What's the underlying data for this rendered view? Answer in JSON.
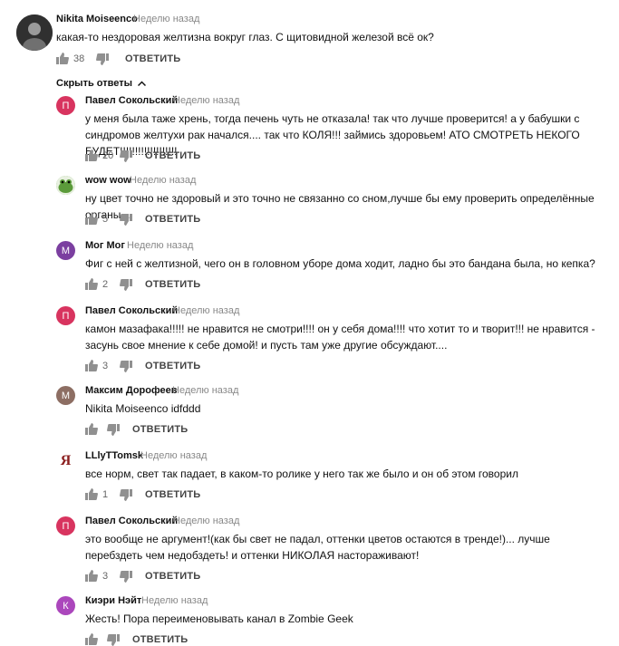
{
  "main_comment": {
    "author": "Nikita Moiseenco",
    "time": "Неделю назад",
    "text": "какая-то нездоровая желтизна вокруг глаз. С щитовидной железой всё ок?",
    "likes": "38",
    "reply_label": "ОТВЕТИТЬ"
  },
  "toggle_label": "Скрыть ответы",
  "replies": [
    {
      "author": "Павел Сокольский",
      "time": "Неделю назад",
      "avatar": "П",
      "avatar_color": "#d8345f",
      "text": "у меня была таже хрень, тогда печень чуть не отказала! так что лучше проверится! а у бабушки с синдромов желтухи рак начался.... так что КОЛЯ!!! займись здоровьем! АТО СМОТРЕТЬ НЕКОГО БУДЕТ!!!!!!!!!!!!!!!!!!!",
      "likes": "20",
      "reply_label": "ОТВЕТИТЬ"
    },
    {
      "author": "wow wow",
      "time": "Неделю назад",
      "avatar": "",
      "avatar_color": "#6aa84f",
      "text": "ну цвет точно не здоровый и это точно не связанно со сном,лучше бы ему проверить определённые органы...",
      "likes": "5",
      "reply_label": "ОТВЕТИТЬ"
    },
    {
      "author": "Мог Мог",
      "time": "Неделю назад",
      "avatar": "М",
      "avatar_color": "#7b3fa0",
      "text": "Фиг с ней с желтизной, чего он в головном уборе дома ходит, ладно бы это бандана была, но кепка?",
      "likes": "2",
      "reply_label": "ОТВЕТИТЬ"
    },
    {
      "author": "Павел Сокольский",
      "time": "Неделю назад",
      "avatar": "П",
      "avatar_color": "#d8345f",
      "text": "камон мазафака!!!!! не нравится не смотри!!!! он у себя дома!!!! что хотит то и творит!!! не нравится - засунь свое мнение к себе домой! и пусть там уже другие обсуждают....",
      "likes": "3",
      "reply_label": "ОТВЕТИТЬ"
    },
    {
      "author": "Максим Дорофеев",
      "time": "Неделю назад",
      "avatar": "М",
      "avatar_color": "#8d6e63",
      "text": "Nikita Moiseenco idfddd",
      "likes": "",
      "reply_label": "ОТВЕТИТЬ"
    },
    {
      "author": "LLlyTTomsk",
      "time": "Неделю назад",
      "avatar": "Я",
      "avatar_color": "#ffffff",
      "text": "все норм, свет так падает, в каком-то ролике у него так же было и он об этом говорил",
      "likes": "1",
      "reply_label": "ОТВЕТИТЬ"
    },
    {
      "author": "Павел Сокольский",
      "time": "Неделю назад",
      "avatar": "П",
      "avatar_color": "#d8345f",
      "text": "это вообще не аргумент!(как бы свет не падал, оттенки цветов остаются в тренде!)... лучше перебздеть чем недобздеть! и оттенки НИКОЛАЯ настораживают!",
      "likes": "3",
      "reply_label": "ОТВЕТИТЬ"
    },
    {
      "author": "Киэри Нэйт",
      "time": "Неделю назад",
      "avatar": "К",
      "avatar_color": "#ab47bc",
      "text": "Жесть! Пора переименовывать канал в Zombie Geek",
      "likes": "",
      "reply_label": "ОТВЕТИТЬ"
    }
  ]
}
